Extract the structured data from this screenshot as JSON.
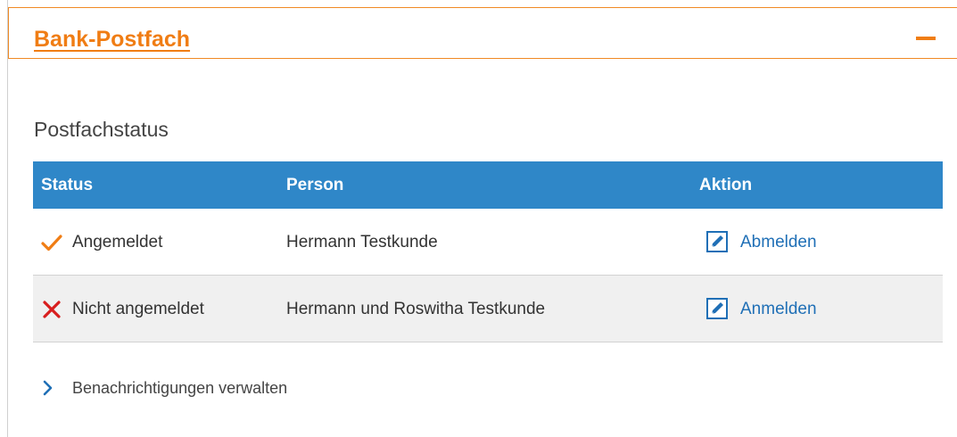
{
  "panel": {
    "title": "Bank-Postfach",
    "accent_color": "#f07d14",
    "collapse_icon": "minus-icon"
  },
  "section": {
    "title": "Postfachstatus"
  },
  "table": {
    "header_color": "#2f87c8",
    "columns": [
      "Status",
      "Person",
      "Aktion"
    ],
    "rows": [
      {
        "status_icon": "checkmark-icon",
        "status": "Angemeldet",
        "person": "Hermann Testkunde",
        "action_icon": "edit-icon",
        "action": "Abmelden"
      },
      {
        "status_icon": "cross-icon",
        "status": "Nicht angemeldet",
        "person": "Hermann und Roswitha Testkunde",
        "action_icon": "edit-icon",
        "action": "Anmelden"
      }
    ]
  },
  "notifications_link": {
    "icon": "chevron-right-icon",
    "label": "Benachrichtigungen verwalten"
  }
}
